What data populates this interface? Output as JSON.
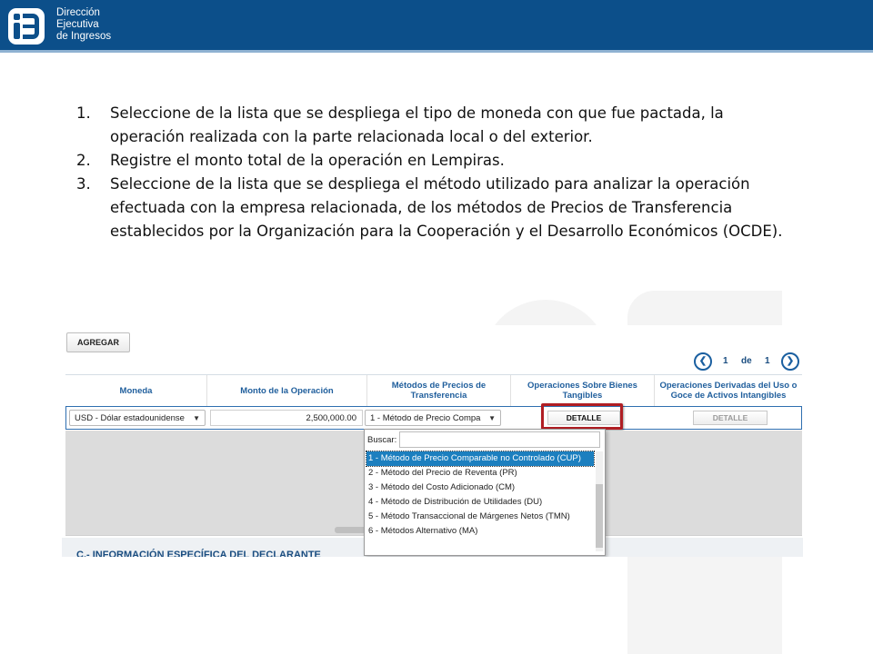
{
  "header": {
    "brand_lines": [
      "Dirección",
      "Ejecutiva",
      "de Ingresos"
    ],
    "background": "#0c4f8a"
  },
  "instructions": [
    {
      "number": "1.",
      "text": "Seleccione de la lista que se despliega el tipo de moneda con que fue pactada, la operación realizada con la parte relacionada local o del exterior."
    },
    {
      "number": "2.",
      "text": "Registre el monto total de la operación en Lempiras."
    },
    {
      "number": "3.",
      "text": "Seleccione de la lista que se despliega el método utilizado para analizar la operación efectuada con la empresa relacionada, de los métodos de Precios de Transferencia establecidos por la Organización para la Cooperación y el Desarrollo Económicos (OCDE)."
    }
  ],
  "form": {
    "add_button": "AGREGAR",
    "pager": {
      "current": "1",
      "of_label": "de",
      "total": "1"
    },
    "columns": [
      "Moneda",
      "Monto de la Operación",
      "Métodos de Precios de Transferencia",
      "Operaciones Sobre Bienes Tangibles",
      "Operaciones Derivadas del Uso o Goce de Activos Intangibles"
    ],
    "row": {
      "currency": "USD - Dólar estadounidense",
      "amount": "2,500,000.00",
      "method": "1 - Método de Precio Compa",
      "tangible_button": "DETALLE",
      "intangible_button": "DETALLE"
    },
    "dropdown": {
      "search_label": "Buscar:",
      "search_value": "",
      "options": [
        "1 - Método de Precio Comparable no Controlado (CUP)",
        "2 - Método del Precio de Reventa (PR)",
        "3 - Método del Costo Adicionado (CM)",
        "4 - Método de Distribución de Utilidades (DU)",
        "5 - Método Transaccional de Márgenes Netos (TMN)",
        "6 - Métodos Alternativo (MA)"
      ],
      "selected_index": 0
    },
    "section_title": "C.- INFORMACIÓN ESPECÍFICA DEL DECLARANTE",
    "highlight_color": "#b01e24",
    "accent_color": "#1f5e9c"
  }
}
